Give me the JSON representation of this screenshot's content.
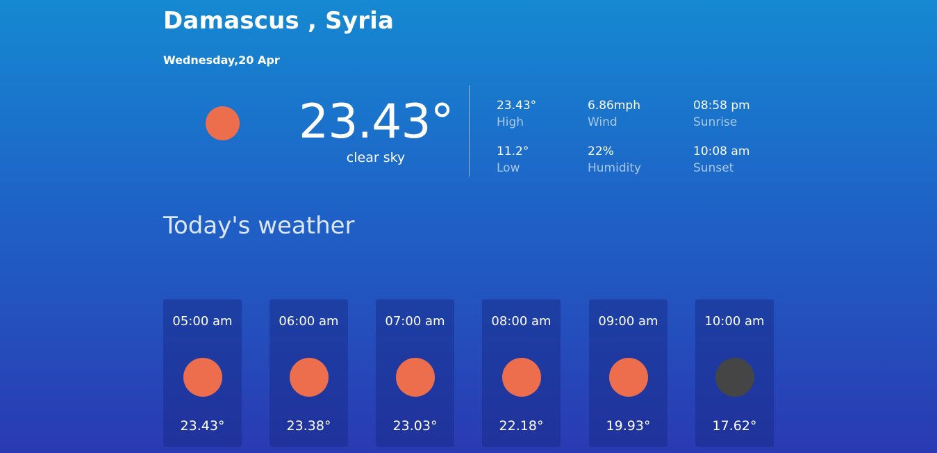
{
  "location": {
    "city_line": "Damascus , Syria",
    "date": "Wednesday,20 Apr"
  },
  "current": {
    "icon": "sun-icon",
    "icon_color": "#ec6e4c",
    "temp": "23.43°",
    "desc": "clear sky"
  },
  "stats": {
    "high": {
      "value": "23.43°",
      "label": "High"
    },
    "low": {
      "value": "11.2°",
      "label": "Low"
    },
    "wind": {
      "value": "6.86mph",
      "label": "Wind"
    },
    "humidity": {
      "value": "22%",
      "label": "Humidity"
    },
    "sunrise": {
      "value": "08:58 pm",
      "label": "Sunrise"
    },
    "sunset": {
      "value": "10:08 am",
      "label": "Sunset"
    }
  },
  "today": {
    "title": "Today's weather",
    "hours": [
      {
        "time": "05:00 am",
        "temp": "23.43°",
        "icon": "sun-icon",
        "color": "#ec6e4c"
      },
      {
        "time": "06:00 am",
        "temp": "23.38°",
        "icon": "sun-icon",
        "color": "#ec6e4c"
      },
      {
        "time": "07:00 am",
        "temp": "23.03°",
        "icon": "sun-icon",
        "color": "#ec6e4c"
      },
      {
        "time": "08:00 am",
        "temp": "22.18°",
        "icon": "sun-icon",
        "color": "#ec6e4c"
      },
      {
        "time": "09:00 am",
        "temp": "19.93°",
        "icon": "sun-icon",
        "color": "#ec6e4c"
      },
      {
        "time": "10:00 am",
        "temp": "17.62°",
        "icon": "moon-icon",
        "color": "#454545"
      }
    ]
  },
  "colors": {
    "bg_top": "#1589d1",
    "bg_bottom": "#2a3ab2",
    "sun": "#ec6e4c",
    "moon": "#454545"
  }
}
